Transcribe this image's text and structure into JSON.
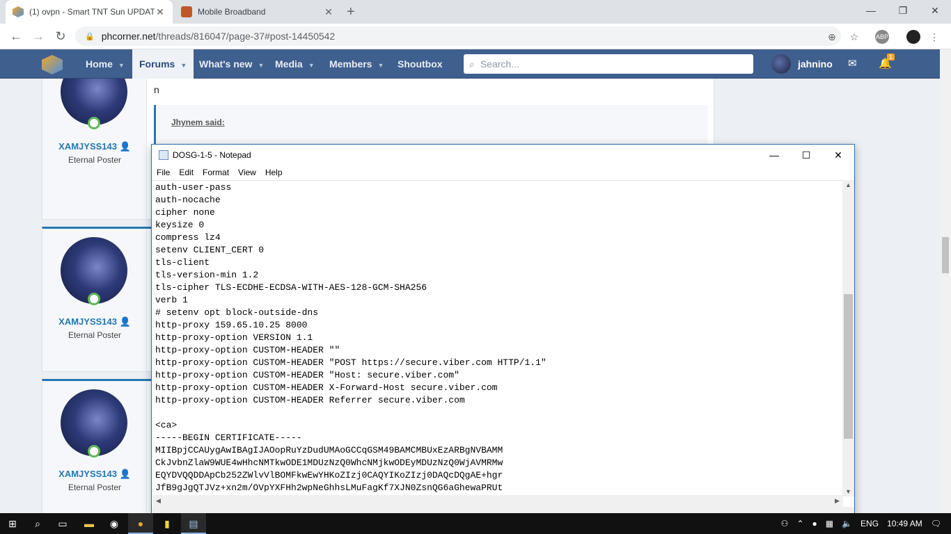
{
  "browser": {
    "tabs": [
      {
        "title": "(1) ovpn - Smart TNT Sun UPDAT",
        "active": true
      },
      {
        "title": "Mobile Broadband",
        "active": false
      }
    ],
    "new_tab": "+",
    "url_host": "phcorner.net",
    "url_path": "/threads/816047/page-37#post-14450542",
    "abp_label": "ABP",
    "window_controls": [
      "—",
      "❐",
      "✕"
    ]
  },
  "site": {
    "nav": [
      {
        "label": "Home",
        "caret": true
      },
      {
        "label": "Forums",
        "caret": true,
        "active": true
      },
      {
        "label": "What's new",
        "caret": true
      },
      {
        "label": "Media",
        "caret": true
      },
      {
        "label": "Members",
        "caret": true
      },
      {
        "label": "Shoutbox",
        "caret": false
      }
    ],
    "search_placeholder": "Search...",
    "username": "jahnino",
    "notification_count": "1"
  },
  "posts": [
    {
      "username": "XAMJYSS143",
      "title": "Eternal Poster",
      "message": "n",
      "quote_author": "Jhynem said:"
    },
    {
      "username": "XAMJYSS143",
      "title": "Eternal Poster"
    },
    {
      "username": "XAMJYSS143",
      "title": "Eternal Poster"
    }
  ],
  "notepad": {
    "title": "DOSG-1-5 - Notepad",
    "menu": [
      "File",
      "Edit",
      "Format",
      "View",
      "Help"
    ],
    "content": "auth-user-pass\nauth-nocache\ncipher none\nkeysize 0\ncompress lz4\nsetenv CLIENT_CERT 0\ntls-client\ntls-version-min 1.2\ntls-cipher TLS-ECDHE-ECDSA-WITH-AES-128-GCM-SHA256\nverb 1\n# setenv opt block-outside-dns\nhttp-proxy 159.65.10.25 8000\nhttp-proxy-option VERSION 1.1\nhttp-proxy-option CUSTOM-HEADER \"\"\nhttp-proxy-option CUSTOM-HEADER \"POST https://secure.viber.com HTTP/1.1\"\nhttp-proxy-option CUSTOM-HEADER \"Host: secure.viber.com\"\nhttp-proxy-option CUSTOM-HEADER X-Forward-Host secure.viber.com\nhttp-proxy-option CUSTOM-HEADER Referrer secure.viber.com\n\n<ca>\n-----BEGIN CERTIFICATE-----\nMIIBpjCCAUygAwIBAgIJAOopRuYzDudUMAoGCCqGSM49BAMCMBUxEzARBgNVBAMM\nCkJvbnZlaW9WUE4wHhcNMTkwODE1MDUzNzQ0WhcNMjkwODEyMDUzNzQ0WjAVMRMw\nEQYDVQQDDApCb252ZWlvVlBOMFkwEwYHKoZIzj0CAQYIKoZIzj0DAQcDQgAE+hgr\nJfB9gJgQTJVz+xn2m/OVpYXFHh2wpNeGhhsLMuFagKf7XJN0ZsnQG6aGhewaPRUt"
  },
  "taskbar": {
    "language": "ENG",
    "time": "10:49 AM"
  }
}
